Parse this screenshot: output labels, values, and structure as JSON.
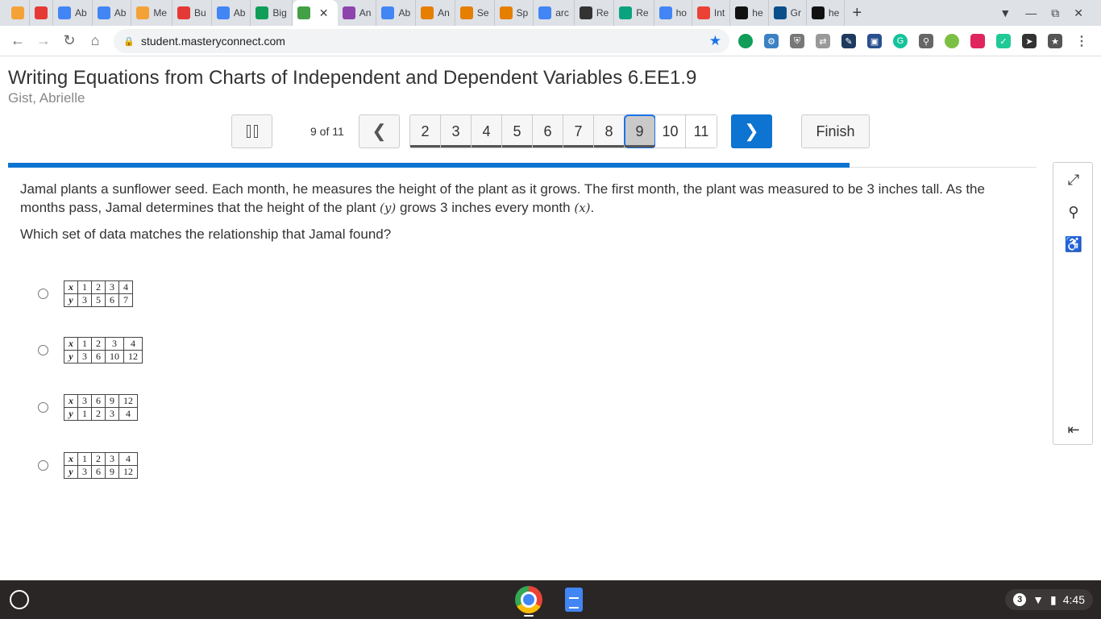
{
  "browser": {
    "tabs": [
      {
        "label": "",
        "color": "#f4a236"
      },
      {
        "label": "",
        "color": "#e53935"
      },
      {
        "label": "Ab",
        "color": "#4285f4"
      },
      {
        "label": "Ab",
        "color": "#4285f4"
      },
      {
        "label": "Me",
        "color": "#f4a236"
      },
      {
        "label": "Bu",
        "color": "#e53935"
      },
      {
        "label": "Ab",
        "color": "#4285f4"
      },
      {
        "label": "Big",
        "color": "#0f9d58"
      },
      {
        "label": "",
        "color": "#43a047",
        "active": true
      },
      {
        "label": "An",
        "color": "#8e44ad"
      },
      {
        "label": "Ab",
        "color": "#4285f4"
      },
      {
        "label": "An",
        "color": "#e67e00"
      },
      {
        "label": "Se",
        "color": "#e67e00"
      },
      {
        "label": "Sp",
        "color": "#e67e00"
      },
      {
        "label": "arc",
        "color": "#4285f4"
      },
      {
        "label": "Re",
        "color": "#333"
      },
      {
        "label": "Re",
        "color": "#0aa37f"
      },
      {
        "label": "ho",
        "color": "#4285f4"
      },
      {
        "label": "Int",
        "color": "#ea4335"
      },
      {
        "label": "he",
        "color": "#111"
      },
      {
        "label": "Gr",
        "color": "#0b4f8a"
      },
      {
        "label": "he",
        "color": "#111"
      }
    ],
    "url": "student.masteryconnect.com"
  },
  "assessment": {
    "title": "Writing Equations from Charts of Independent and Dependent Variables 6.EE1.9",
    "student": "Gist, Abrielle",
    "progress_label": "9 of 11",
    "progress_fraction": 0.818,
    "question_numbers": [
      "2",
      "3",
      "4",
      "5",
      "6",
      "7",
      "8",
      "9",
      "10",
      "11"
    ],
    "current_question": "9",
    "finish_label": "Finish"
  },
  "question": {
    "text_part1": "Jamal plants a sunflower seed. Each month, he measures the height of the plant as it grows. The first month, the plant was measured to be 3 inches tall. As the months pass, Jamal determines that the height of the plant ",
    "var_y": "(y)",
    "text_part2": " grows 3 inches every month ",
    "var_x": "(x)",
    "text_part3": ".",
    "prompt": "Which set of data matches the relationship that Jamal found?"
  },
  "choices": [
    {
      "x_label": "x",
      "y_label": "y",
      "x": [
        "1",
        "2",
        "3",
        "4"
      ],
      "y": [
        "3",
        "5",
        "6",
        "7"
      ]
    },
    {
      "x_label": "x",
      "y_label": "y",
      "x": [
        "1",
        "2",
        "3",
        "4"
      ],
      "y": [
        "3",
        "6",
        "10",
        "12"
      ]
    },
    {
      "x_label": "x",
      "y_label": "y",
      "x": [
        "3",
        "6",
        "9",
        "12"
      ],
      "y": [
        "1",
        "2",
        "3",
        "4"
      ]
    },
    {
      "x_label": "x",
      "y_label": "y",
      "x": [
        "1",
        "2",
        "3",
        "4"
      ],
      "y": [
        "3",
        "6",
        "9",
        "12"
      ]
    }
  ],
  "shelf": {
    "notification_count": "3",
    "time": "4:45"
  }
}
